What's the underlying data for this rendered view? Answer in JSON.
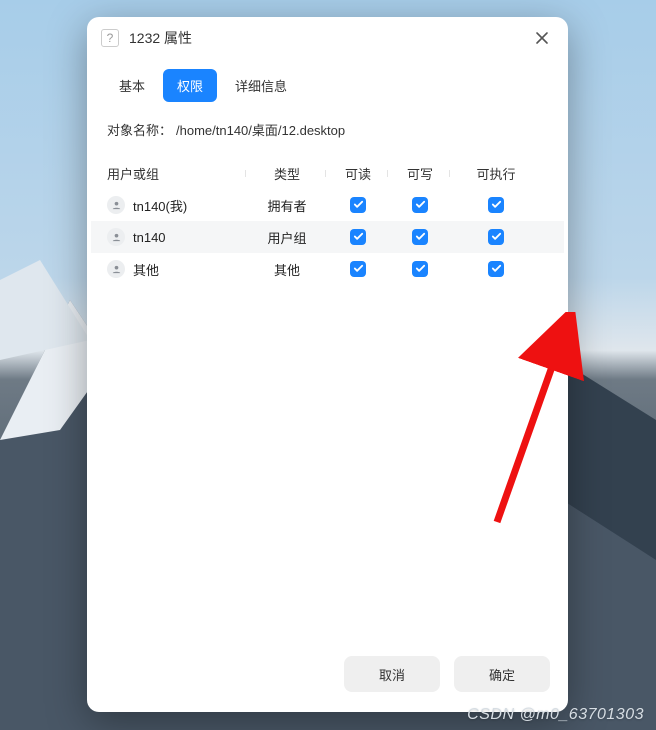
{
  "window": {
    "title": "1232 属性",
    "close_icon": "close-icon"
  },
  "tabs": [
    {
      "label": "基本",
      "active": false
    },
    {
      "label": "权限",
      "active": true
    },
    {
      "label": "详细信息",
      "active": false
    }
  ],
  "object": {
    "label": "对象名称：",
    "path": "/home/tn140/桌面/12.desktop"
  },
  "perm_headers": {
    "user_or_group": "用户或组",
    "type": "类型",
    "read": "可读",
    "write": "可写",
    "exec": "可执行"
  },
  "perm_rows": [
    {
      "name": "tn140(我)",
      "type": "拥有者",
      "read": true,
      "write": true,
      "exec": true
    },
    {
      "name": "tn140",
      "type": "用户组",
      "read": true,
      "write": true,
      "exec": true
    },
    {
      "name": "其他",
      "type": "其他",
      "read": true,
      "write": true,
      "exec": true
    }
  ],
  "buttons": {
    "cancel": "取消",
    "ok": "确定"
  },
  "watermark": "CSDN @m0_63701303"
}
